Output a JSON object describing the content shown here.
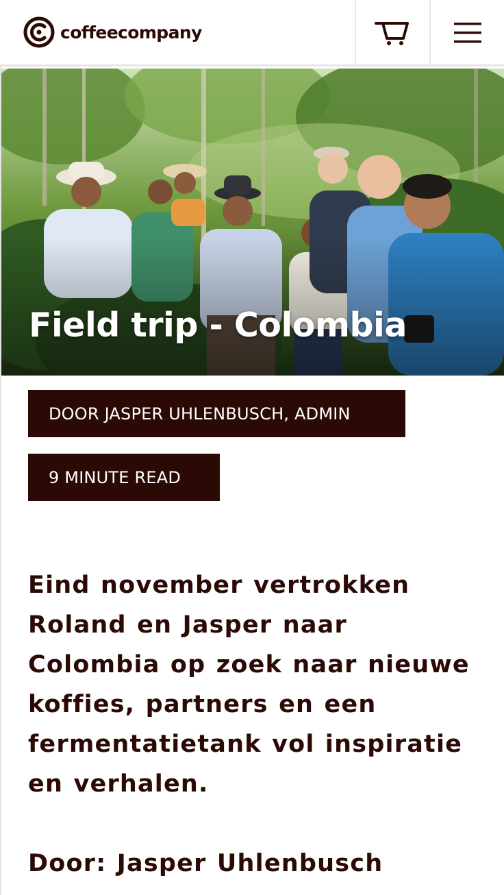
{
  "brand": {
    "name": "coffeecompany",
    "color": "#2b0a06"
  },
  "header": {
    "cart_icon": "shopping-cart-icon",
    "menu_icon": "hamburger-menu-icon"
  },
  "hero": {
    "title": "Field trip - Colombia",
    "image": "group-of-coffee-farmers-and-visitors-photo"
  },
  "tags": {
    "author": "DOOR JASPER UHLENBUSCH, ADMIN",
    "read_time": "9 MINUTE READ"
  },
  "article": {
    "intro": "Eind november vertrokken Roland en Jasper naar Colombia op zoek naar nieuwe koffies, partners en een fermentatietank vol inspiratie en verhalen.",
    "byline": "Door: Jasper Uhlenbusch"
  }
}
